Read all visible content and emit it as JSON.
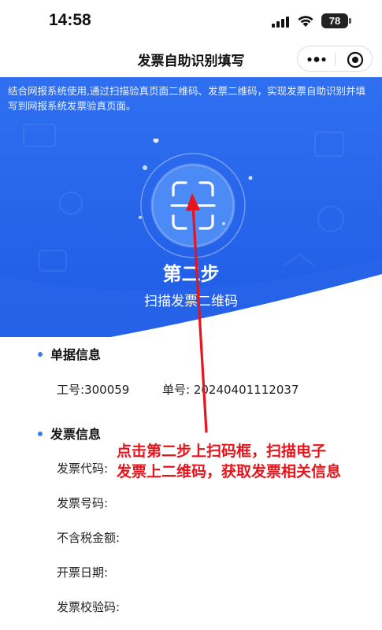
{
  "status_bar": {
    "time": "14:58",
    "battery": "78"
  },
  "nav": {
    "title": "发票自助识别填写"
  },
  "hero": {
    "description": "结合网报系统使用,通过扫描验真页面二维码、发票二维码，实现发票自助识别并填写到网报系统发票验真页面。",
    "step_title": "第二步",
    "step_subtitle": "扫描发票二维码"
  },
  "doc_section": {
    "title": "单据信息",
    "employee_label": "工号:",
    "employee_value": "300059",
    "doc_no_label": "单号:",
    "doc_no_value": "20240401112037"
  },
  "invoice_section": {
    "title": "发票信息",
    "fields": [
      "发票代码:",
      "发票号码:",
      "不含税金额:",
      "开票日期:",
      "发票校验码:"
    ]
  },
  "annotation": {
    "line1": "点击第二步上扫码框，扫描电子",
    "line2": "发票上二维码，获取发票相关信息"
  },
  "colors": {
    "hero_blue": "#2a6ef0",
    "accent": "#3b7cf0",
    "annotation_red": "#e8141c"
  }
}
